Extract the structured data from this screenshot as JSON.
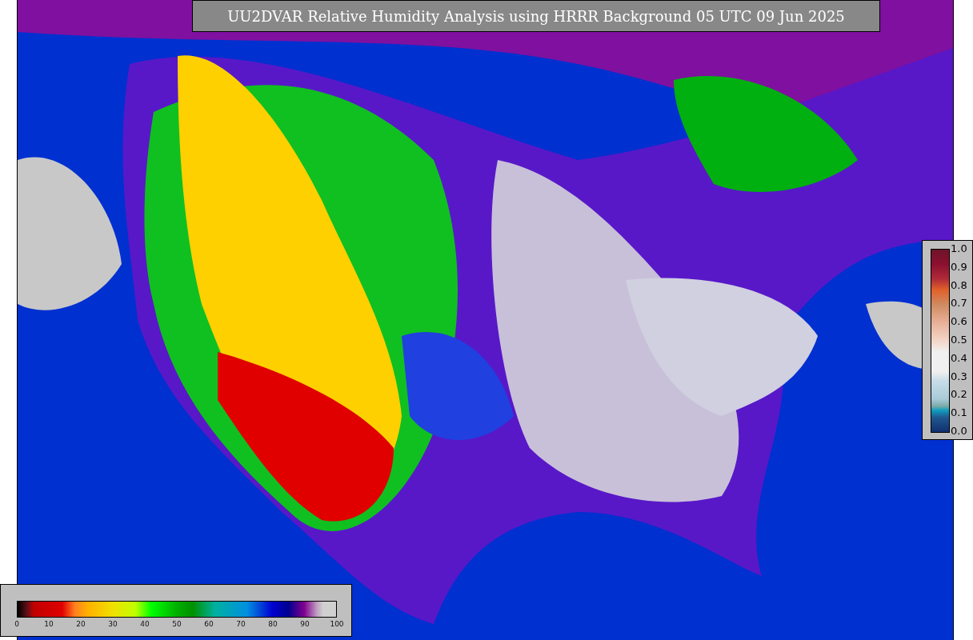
{
  "title": "UU2DVAR Relative Humidity Analysis using HRRR Background 05 UTC 09 Jun 2025",
  "error_legend": {
    "ticks": [
      "1.0",
      "0.9",
      "0.8",
      "0.7",
      "0.6",
      "0.5",
      "0.4",
      "0.3",
      "0.2",
      "0.1",
      "0.0"
    ]
  },
  "humidity_legend": {
    "ticks": [
      "0",
      "10",
      "20",
      "30",
      "40",
      "50",
      "60",
      "70",
      "80",
      "90",
      "100"
    ]
  }
}
